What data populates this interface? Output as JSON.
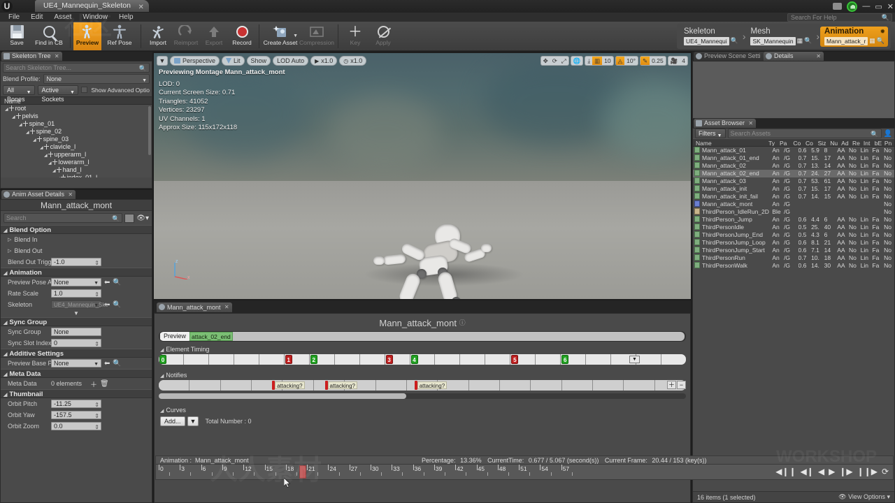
{
  "window": {
    "tab_title": "UE4_Mannequin_Skeleton",
    "logo": "unreal-logo",
    "minimize": "—",
    "maximize": "▭",
    "close": "✕"
  },
  "menu": {
    "items": [
      "File",
      "Edit",
      "Asset",
      "Window",
      "Help"
    ]
  },
  "help_search": {
    "placeholder": "Search For Help"
  },
  "toolbar": {
    "items": [
      {
        "label": "Save",
        "icon": "save-icon",
        "state": "normal"
      },
      {
        "label": "Find in CB",
        "icon": "magnifier-icon",
        "state": "normal"
      },
      {
        "label": "Preview",
        "icon": "preview-mannequin-icon",
        "state": "selected"
      },
      {
        "label": "Ref Pose",
        "icon": "ref-pose-icon",
        "state": "normal"
      },
      {
        "label": "Import",
        "icon": "import-icon",
        "state": "normal"
      },
      {
        "label": "Reimport",
        "icon": "reimport-icon",
        "state": "disabled"
      },
      {
        "label": "Export",
        "icon": "export-icon",
        "state": "disabled"
      },
      {
        "label": "Record",
        "icon": "record-icon",
        "state": "normal"
      },
      {
        "label": "Create Asset",
        "icon": "create-asset-icon",
        "state": "normal",
        "dropdown": true
      },
      {
        "label": "Compression",
        "icon": "compression-icon",
        "state": "disabled"
      },
      {
        "label": "Key",
        "icon": "plus-key-icon",
        "state": "disabled"
      },
      {
        "label": "Apply",
        "icon": "apply-icon",
        "state": "disabled"
      }
    ]
  },
  "breadcrumb": {
    "segments": [
      {
        "title": "Skeleton",
        "value": "UE4_Mannequi",
        "active": false,
        "browse_icon": false
      },
      {
        "title": "Mesh",
        "value": "SK_Mannequin",
        "active": false,
        "browse_icon": true
      },
      {
        "title": "Animation",
        "value": "Mann_attack_r",
        "active": true,
        "browse_icon": true
      }
    ],
    "separator": "›"
  },
  "skeleton_tree": {
    "tab_label": "Skeleton Tree",
    "search_placeholder": "Search Skeleton Tree...",
    "blend_profile_label": "Blend Profile:",
    "blend_profile_value": "None",
    "bones_filter": "All Bones",
    "sockets_filter": "Active Sockets",
    "show_advanced_label": "Show Advanced Optio",
    "column_header": "Name",
    "nodes": [
      {
        "label": "root",
        "depth": 0
      },
      {
        "label": "pelvis",
        "depth": 1
      },
      {
        "label": "spine_01",
        "depth": 2
      },
      {
        "label": "spine_02",
        "depth": 3
      },
      {
        "label": "spine_03",
        "depth": 4
      },
      {
        "label": "clavicle_l",
        "depth": 5
      },
      {
        "label": "upperarm_l",
        "depth": 6
      },
      {
        "label": "lowerarm_l",
        "depth": 7
      },
      {
        "label": "hand_l",
        "depth": 8
      },
      {
        "label": "index_01_l",
        "depth": 9
      }
    ]
  },
  "anim_details": {
    "tab_label": "Anim Asset Details",
    "asset_name": "Mann_attack_mont",
    "search_placeholder": "Search",
    "sections": [
      {
        "title": "Blend Option",
        "rows": [
          {
            "label": "Blend In",
            "type": "expander"
          },
          {
            "label": "Blend Out",
            "type": "expander"
          },
          {
            "label": "Blend Out Trigge",
            "type": "spin",
            "value": "-1.0"
          }
        ]
      },
      {
        "title": "Animation",
        "rows": [
          {
            "label": "Preview Pose As",
            "type": "combo",
            "value": "None"
          },
          {
            "label": "Rate Scale",
            "type": "spin",
            "value": "1.0"
          },
          {
            "label": "Skeleton",
            "type": "combo-dim",
            "value": "UE4_Mannequin_Ske"
          }
        ]
      },
      {
        "title": "Sync Group",
        "rows": [
          {
            "label": "Sync Group",
            "type": "text",
            "value": "None"
          },
          {
            "label": "Sync Slot Index",
            "type": "spin",
            "value": "0"
          }
        ]
      },
      {
        "title": "Additive Settings",
        "rows": [
          {
            "label": "Preview Base Po:",
            "type": "combo",
            "value": "None"
          }
        ]
      },
      {
        "title": "Meta Data",
        "rows": [
          {
            "label": "Meta Data",
            "type": "elements",
            "value": "0 elements"
          }
        ]
      },
      {
        "title": "Thumbnail",
        "rows": [
          {
            "label": "Orbit Pitch",
            "type": "spin",
            "value": "-11.25"
          },
          {
            "label": "Orbit Yaw",
            "type": "spin",
            "value": "-157.5"
          },
          {
            "label": "Orbit Zoom",
            "type": "spin",
            "value": "0.0"
          }
        ]
      }
    ]
  },
  "viewport": {
    "buttons": [
      "Perspective",
      "Lit",
      "Show",
      "LOD Auto"
    ],
    "speed_camera": "x1.0",
    "speed_anim": "x1.0",
    "preview_title": "Previewing Montage Mann_attack_mont",
    "stats": [
      "LOD: 0",
      "Current Screen Size: 0.71",
      "Triangles: 41052",
      "Vertices: 23297",
      "UV Channels: 1",
      "Approx Size: 115x172x118"
    ],
    "grid_snap": "10",
    "rotation_snap": "10°",
    "scale_snap": "0.25",
    "camera_speed": "4",
    "axis_labels": [
      "z",
      "x"
    ]
  },
  "right_panel": {
    "tabs": [
      {
        "label": "Preview Scene Setti",
        "active": false
      },
      {
        "label": "Details",
        "active": true
      }
    ]
  },
  "asset_browser": {
    "tab_label": "Asset Browser",
    "filters_label": "Filters",
    "search_placeholder": "Search Assets",
    "columns": [
      "Name",
      "Ty",
      "Pa",
      "Co",
      "Co",
      "Siz",
      "Nu",
      "Ad",
      "Re",
      "Int",
      "bE",
      "Pn"
    ],
    "rows": [
      {
        "name": "Mann_attack_01",
        "icon": "anim-icon",
        "cells": [
          "An",
          "/G",
          "0.6",
          "5.9",
          "8",
          "AA",
          "No",
          "Lin",
          "Fa",
          "No"
        ],
        "selected": false
      },
      {
        "name": "Mann_attack_01_end",
        "icon": "anim-icon",
        "cells": [
          "An",
          "/G",
          "0.7",
          "15.",
          "17",
          "AA",
          "No",
          "Lin",
          "Fa",
          "No"
        ],
        "selected": false
      },
      {
        "name": "Mann_attack_02",
        "icon": "anim-icon",
        "cells": [
          "An",
          "/G",
          "0.7",
          "13.",
          "14",
          "AA",
          "No",
          "Lin",
          "Fa",
          "No"
        ],
        "selected": false
      },
      {
        "name": "Mann_attack_02_end",
        "icon": "anim-icon",
        "cells": [
          "An",
          "/G",
          "0.7",
          "24.",
          "27",
          "AA",
          "No",
          "Lin",
          "Fa",
          "No"
        ],
        "selected": true
      },
      {
        "name": "Mann_attack_03",
        "icon": "anim-icon",
        "cells": [
          "An",
          "/G",
          "0.7",
          "53.",
          "61",
          "AA",
          "No",
          "Lin",
          "Fa",
          "No"
        ],
        "selected": false
      },
      {
        "name": "Mann_attack_init",
        "icon": "anim-icon",
        "cells": [
          "An",
          "/G",
          "0.7",
          "15.",
          "17",
          "AA",
          "No",
          "Lin",
          "Fa",
          "No"
        ],
        "selected": false
      },
      {
        "name": "Mann_attack_init_fail",
        "icon": "anim-icon",
        "cells": [
          "An",
          "/G",
          "0.7",
          "14.",
          "15",
          "AA",
          "No",
          "Lin",
          "Fa",
          "No"
        ],
        "selected": false
      },
      {
        "name": "Mann_attack_mont",
        "icon": "montage-icon",
        "cells": [
          "An",
          "/G",
          "",
          "",
          "",
          "",
          "",
          "",
          "",
          "No"
        ],
        "selected": false
      },
      {
        "name": "ThirdPerson_IdleRun_2D",
        "icon": "blendspace-icon",
        "cells": [
          "Ble",
          "/G",
          "",
          "",
          "",
          "",
          "",
          "",
          "",
          "No"
        ],
        "selected": false
      },
      {
        "name": "ThirdPerson_Jump",
        "icon": "anim-icon",
        "cells": [
          "An",
          "/G",
          "0.6",
          "4.4",
          "6",
          "AA",
          "No",
          "Lin",
          "Fa",
          "No"
        ],
        "selected": false
      },
      {
        "name": "ThirdPersonIdle",
        "icon": "anim-icon",
        "cells": [
          "An",
          "/G",
          "0.5",
          "25.",
          "40",
          "AA",
          "No",
          "Lin",
          "Fa",
          "No"
        ],
        "selected": false
      },
      {
        "name": "ThirdPersonJump_End",
        "icon": "anim-icon",
        "cells": [
          "An",
          "/G",
          "0.5",
          "4.3",
          "6",
          "AA",
          "No",
          "Lin",
          "Fa",
          "No"
        ],
        "selected": false
      },
      {
        "name": "ThirdPersonJump_Loop",
        "icon": "anim-icon",
        "cells": [
          "An",
          "/G",
          "0.6",
          "8.1",
          "21",
          "AA",
          "No",
          "Lin",
          "Fa",
          "No"
        ],
        "selected": false
      },
      {
        "name": "ThirdPersonJump_Start",
        "icon": "anim-icon",
        "cells": [
          "An",
          "/G",
          "0.6",
          "7.1",
          "14",
          "AA",
          "No",
          "Lin",
          "Fa",
          "No"
        ],
        "selected": false
      },
      {
        "name": "ThirdPersonRun",
        "icon": "anim-icon",
        "cells": [
          "An",
          "/G",
          "0.7",
          "10.",
          "18",
          "AA",
          "No",
          "Lin",
          "Fa",
          "No"
        ],
        "selected": false
      },
      {
        "name": "ThirdPersonWalk",
        "icon": "anim-icon",
        "cells": [
          "An",
          "/G",
          "0.6",
          "14.",
          "30",
          "AA",
          "No",
          "Lin",
          "Fa",
          "No"
        ],
        "selected": false
      }
    ],
    "status": "16 items (1 selected)",
    "view_options": "View Options"
  },
  "montage": {
    "tab_label": "Mann_attack_mont",
    "title": "Mann_attack_mont",
    "preview_label": "Preview",
    "segment_label": "attack_02_end",
    "element_timing_label": "Element Timing",
    "notifies_label": "Notifies",
    "curves_label": "Curves",
    "curves_add_label": "Add...",
    "curves_total": "Total Number : 0",
    "element_markers": [
      {
        "index": "0",
        "color": "green",
        "cell": 0
      },
      {
        "index": "1",
        "color": "red",
        "cell": 5
      },
      {
        "index": "2",
        "color": "green",
        "cell": 6
      },
      {
        "index": "3",
        "color": "red",
        "cell": 9
      },
      {
        "index": "4",
        "color": "green",
        "cell": 10
      },
      {
        "index": "5",
        "color": "red",
        "cell": 14
      },
      {
        "index": "6",
        "color": "green",
        "cell": 16
      }
    ],
    "notifies": [
      {
        "label": "attacking?",
        "left_pct": 21.5
      },
      {
        "label": "attacking?",
        "left_pct": 31.5
      },
      {
        "label": "attacking?",
        "left_pct": 48.5
      }
    ]
  },
  "timeline": {
    "animation_label": "Animation :",
    "animation_name": "Mann_attack_mont",
    "percentage_label": "Percentage:",
    "percentage_value": "13.36%",
    "current_time_label": "CurrentTime:",
    "current_time_value": "0.677 / 5.067 (second(s))",
    "current_frame_label": "Current Frame:",
    "current_frame_value": "20.44 / 153 (key(s))",
    "tick_labels": [
      "0",
      "3",
      "6",
      "9",
      "12",
      "15",
      "18",
      "21",
      "24",
      "27",
      "30",
      "33",
      "36",
      "39",
      "42",
      "45",
      "48",
      "51",
      "54",
      "57"
    ],
    "playhead_frame": 20.44,
    "transport": [
      "step-back-begin",
      "step-back",
      "play-reverse",
      "play-forward",
      "step-forward",
      "step-forward-end",
      "loop"
    ]
  },
  "colors": {
    "accent_orange": "#f6a623",
    "panel_bg": "#4a4a4a",
    "marker_green": "#21a021",
    "marker_red": "#bf1f1f",
    "segment_green": "#7bbf74",
    "playhead": "#c05a5a"
  }
}
